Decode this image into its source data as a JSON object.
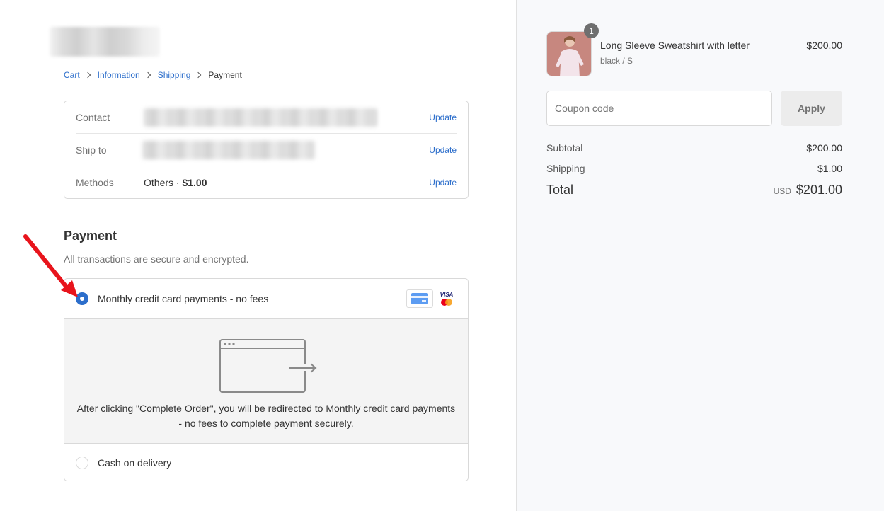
{
  "breadcrumb": {
    "cart": "Cart",
    "information": "Information",
    "shipping": "Shipping",
    "payment": "Payment"
  },
  "review": {
    "contact_label": "Contact",
    "ship_to_label": "Ship to",
    "methods_label": "Methods",
    "methods_value_name": "Others · ",
    "methods_value_price": "$1.00",
    "update_label": "Update"
  },
  "payment": {
    "title": "Payment",
    "subtitle": "All transactions are secure and encrypted.",
    "options": [
      {
        "label": "Monthly credit card payments - no fees",
        "selected": true
      },
      {
        "label": "Cash on delivery",
        "selected": false
      }
    ],
    "card_icons": [
      "credit-card-icon",
      "visa-mastercard-icon"
    ],
    "visa_text": "VISA",
    "redirect_text": "After clicking \"Complete Order\", you will be redirected to Monthly credit card payments - no fees to complete payment securely."
  },
  "summary": {
    "product": {
      "name": "Long Sleeve Sweatshirt with letter",
      "variant": "black / S",
      "price": "$200.00",
      "quantity": "1"
    },
    "coupon_placeholder": "Coupon code",
    "apply_label": "Apply",
    "subtotal_label": "Subtotal",
    "subtotal_value": "$200.00",
    "shipping_label": "Shipping",
    "shipping_value": "$1.00",
    "total_label": "Total",
    "total_currency": "USD",
    "total_value": "$201.00"
  },
  "colors": {
    "accent": "#2c6ecb",
    "annotation_arrow": "#e8141c"
  }
}
